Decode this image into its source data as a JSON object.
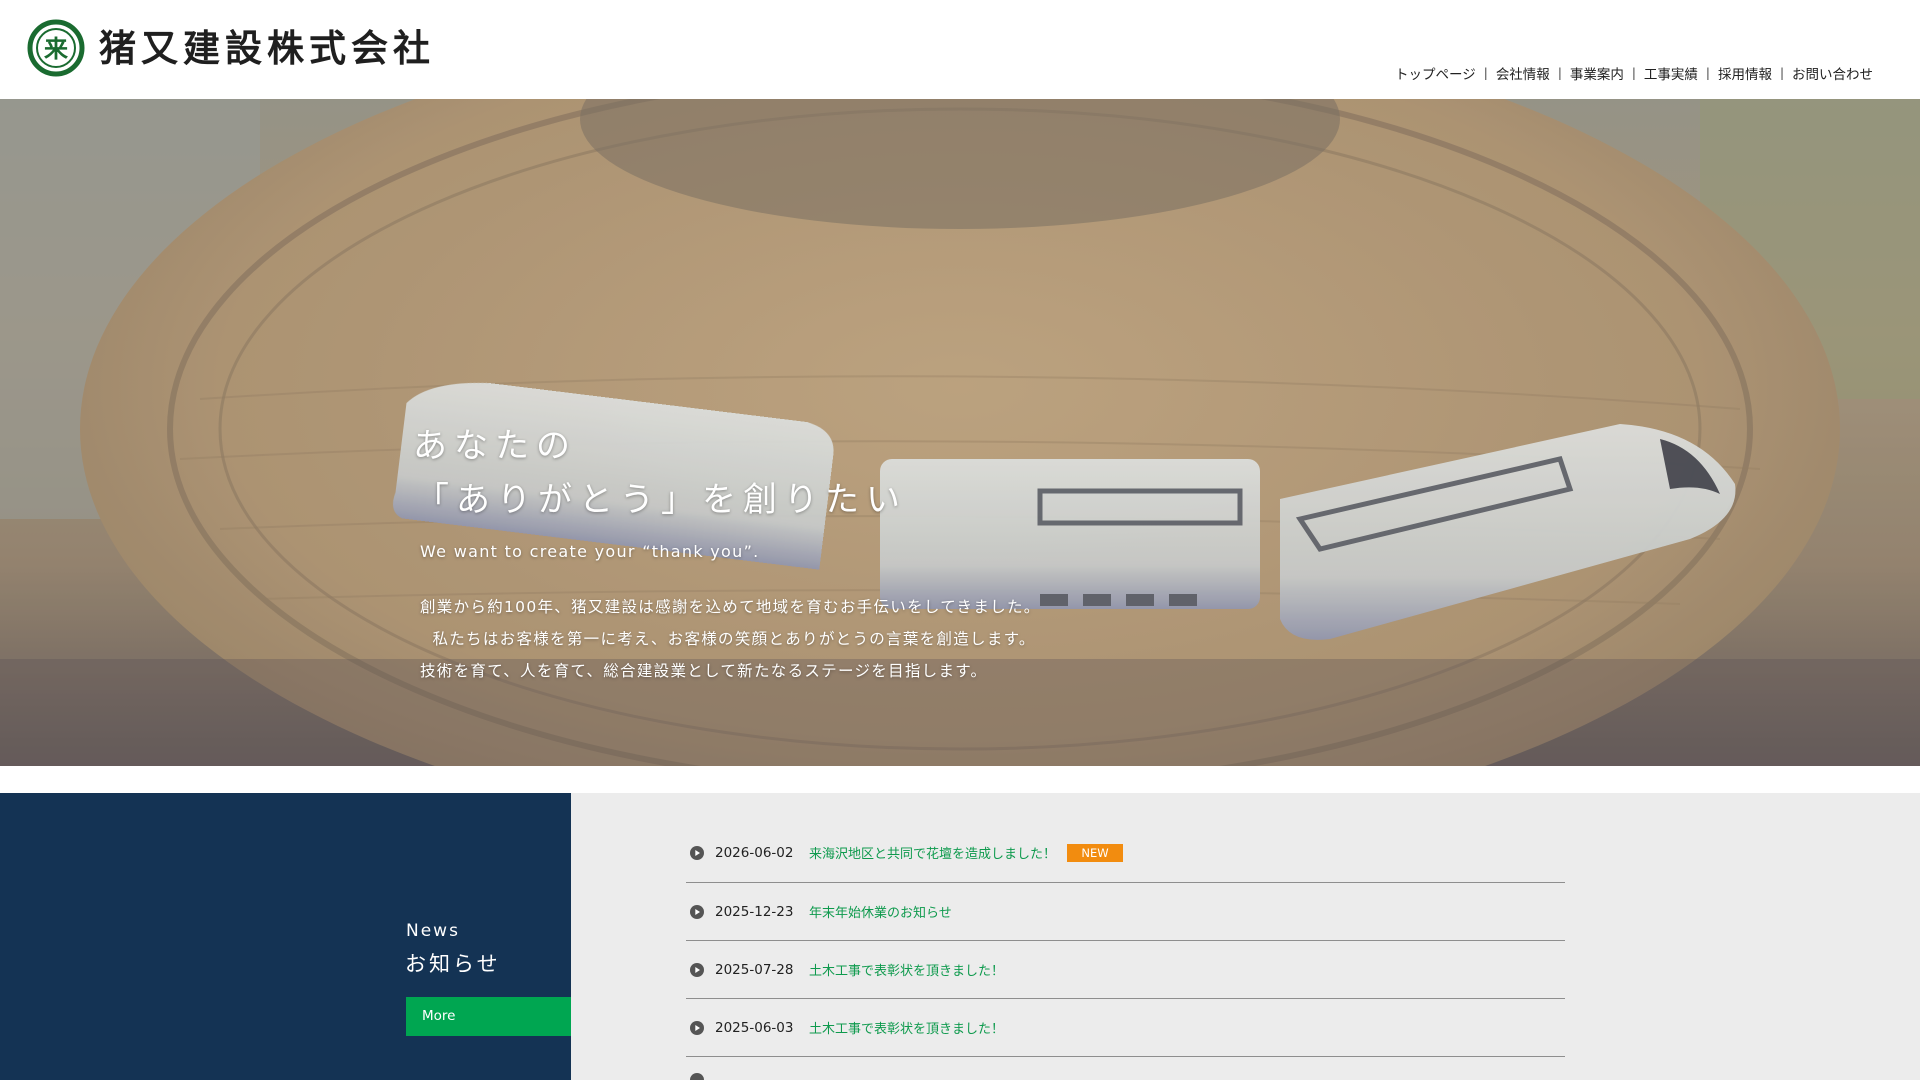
{
  "header": {
    "company_name": "猪又建設株式会社",
    "logo_mark_char": "来",
    "brand_color": "#1a6b30"
  },
  "nav": {
    "items": [
      {
        "label": "トップページ"
      },
      {
        "label": "会社情報"
      },
      {
        "label": "事業案内"
      },
      {
        "label": "工事実績"
      },
      {
        "label": "採用情報"
      },
      {
        "label": "お問い合わせ"
      }
    ],
    "separator": "|"
  },
  "hero": {
    "headline_line1": "あなたの",
    "headline_line2": "「ありがとう」を創りたい",
    "subheadline": "We want to create your “thank you”.",
    "description": [
      "創業から約100年、猪又建設は感謝を込めて地域を育むお手伝いをしてきました。",
      "  私たちはお客様を第一に考え、お客様の笑顔とありがとうの言葉を創造します。",
      "技術を育て、人を育て、総合建設業として新たなるステージを目指します。"
    ]
  },
  "news": {
    "heading_en": "News",
    "heading_ja": "お知らせ",
    "more_label": "More",
    "panel_color": "#143354",
    "more_color": "#00a651",
    "items": [
      {
        "date": "2026-06-02",
        "title": "来海沢地区と共同で花壇を造成しました！",
        "badge": "NEW"
      },
      {
        "date": "2025-12-23",
        "title": "年末年始休業のお知らせ"
      },
      {
        "date": "2025-07-28",
        "title": "土木工事で表彰状を頂きました！"
      },
      {
        "date": "2025-06-03",
        "title": "土木工事で表彰状を頂きました！"
      }
    ]
  }
}
